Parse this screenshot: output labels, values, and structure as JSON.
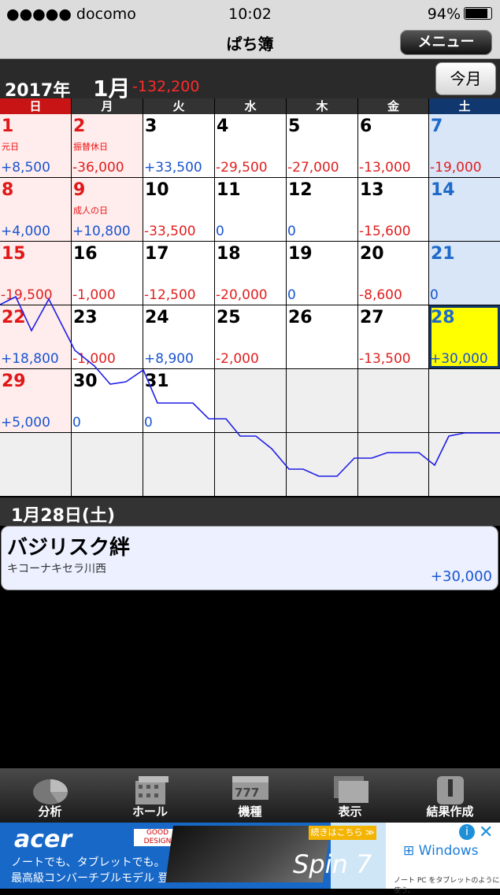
{
  "status": {
    "carrier": "●●●●● docomo",
    "time": "10:02",
    "battery": "94%"
  },
  "nav": {
    "title": "ぱち簿",
    "menu": "メニュー"
  },
  "month": {
    "year": "2017年",
    "month": "1月",
    "total": "-132,200",
    "today_btn": "今月"
  },
  "weekdays": [
    "日",
    "月",
    "火",
    "水",
    "木",
    "金",
    "土"
  ],
  "colors": {
    "sun_header": "#c81414",
    "sat_header": "#10386e",
    "weekday_header": "#333333",
    "sun_bg": "#ffecec",
    "sat_bg": "#d8e6f8",
    "plus": "#1a55d0",
    "minus": "#e02020",
    "selected": "#ffff00"
  },
  "weeks": [
    [
      {
        "day": "1",
        "holiday": "元日",
        "amount": "+8,500"
      },
      {
        "day": "2",
        "holiday": "振替休日",
        "amount": "-36,000"
      },
      {
        "day": "3",
        "holiday": "",
        "amount": "+33,500"
      },
      {
        "day": "4",
        "holiday": "",
        "amount": "-29,500"
      },
      {
        "day": "5",
        "holiday": "",
        "amount": "-27,000"
      },
      {
        "day": "6",
        "holiday": "",
        "amount": "-13,000"
      },
      {
        "day": "7",
        "holiday": "",
        "amount": "-19,000"
      }
    ],
    [
      {
        "day": "8",
        "holiday": "",
        "amount": "+4,000"
      },
      {
        "day": "9",
        "holiday": "成人の日",
        "amount": "+10,800"
      },
      {
        "day": "10",
        "holiday": "",
        "amount": "-33,500"
      },
      {
        "day": "11",
        "holiday": "",
        "amount": "0"
      },
      {
        "day": "12",
        "holiday": "",
        "amount": "0"
      },
      {
        "day": "13",
        "holiday": "",
        "amount": "-15,600"
      },
      {
        "day": "14",
        "holiday": "",
        "amount": ""
      }
    ],
    [
      {
        "day": "15",
        "holiday": "",
        "amount": "-19,500"
      },
      {
        "day": "16",
        "holiday": "",
        "amount": "-1,000"
      },
      {
        "day": "17",
        "holiday": "",
        "amount": "-12,500"
      },
      {
        "day": "18",
        "holiday": "",
        "amount": "-20,000"
      },
      {
        "day": "19",
        "holiday": "",
        "amount": "0"
      },
      {
        "day": "20",
        "holiday": "",
        "amount": "-8,600"
      },
      {
        "day": "21",
        "holiday": "",
        "amount": "0"
      }
    ],
    [
      {
        "day": "22",
        "holiday": "",
        "amount": "+18,800"
      },
      {
        "day": "23",
        "holiday": "",
        "amount": "-1,000"
      },
      {
        "day": "24",
        "holiday": "",
        "amount": "+8,900"
      },
      {
        "day": "25",
        "holiday": "",
        "amount": "-2,000"
      },
      {
        "day": "26",
        "holiday": "",
        "amount": ""
      },
      {
        "day": "27",
        "holiday": "",
        "amount": "-13,500"
      },
      {
        "day": "28",
        "holiday": "",
        "amount": "+30,000",
        "selected": true
      }
    ],
    [
      {
        "day": "29",
        "holiday": "",
        "amount": "+5,000"
      },
      {
        "day": "30",
        "holiday": "",
        "amount": "0"
      },
      {
        "day": "31",
        "holiday": "",
        "amount": "0"
      },
      {
        "day": "",
        "holiday": "",
        "amount": ""
      },
      {
        "day": "",
        "holiday": "",
        "amount": ""
      },
      {
        "day": "",
        "holiday": "",
        "amount": ""
      },
      {
        "day": "",
        "holiday": "",
        "amount": ""
      }
    ],
    [
      {
        "day": "",
        "holiday": "",
        "amount": ""
      },
      {
        "day": "",
        "holiday": "",
        "amount": ""
      },
      {
        "day": "",
        "holiday": "",
        "amount": ""
      },
      {
        "day": "",
        "holiday": "",
        "amount": ""
      },
      {
        "day": "",
        "holiday": "",
        "amount": ""
      },
      {
        "day": "",
        "holiday": "",
        "amount": ""
      },
      {
        "day": "",
        "holiday": "",
        "amount": ""
      }
    ]
  ],
  "selected_day": {
    "header": "1月28日(土)",
    "machine": "バジリスク絆",
    "hall": "キコーナキセラ川西",
    "amount": "+30,000"
  },
  "tabs": [
    {
      "label": "分析",
      "icon": "pie-chart-icon"
    },
    {
      "label": "ホール",
      "icon": "building-icon"
    },
    {
      "label": "機種",
      "icon": "slot-machine-icon"
    },
    {
      "label": "表示",
      "icon": "display-icon"
    },
    {
      "label": "結果作成",
      "icon": "exclamation-icon"
    }
  ],
  "ad": {
    "brand": "acer",
    "line1": "ノートでも、タブレットでも。",
    "line2": "最高級コンバーチブルモデル 登場。",
    "badge": "GOOD DESIGN",
    "cta": "続きはこちら ≫",
    "product": "Spin 7",
    "windows": "Windows",
    "windows_sub": "ノート PC をタブレットのように使う。"
  }
}
